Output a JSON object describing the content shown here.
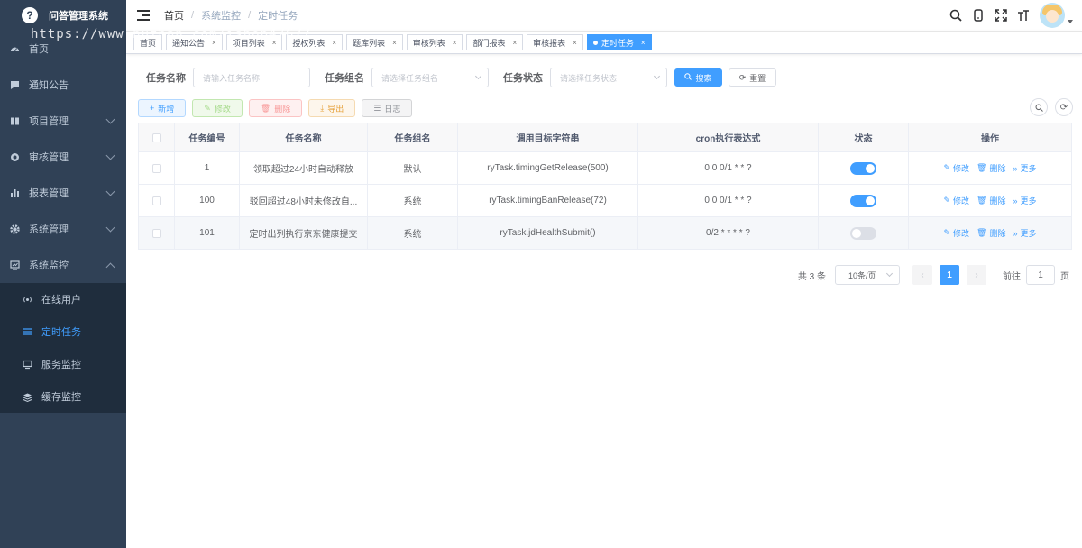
{
  "app": {
    "title": "问答管理系统",
    "logo_glyph": "?"
  },
  "watermark": "https://www.huzhan.com/ishop47677",
  "sidebar": {
    "items": [
      {
        "label": "首页",
        "icon": "dashboard-icon"
      },
      {
        "label": "通知公告",
        "icon": "message-icon"
      },
      {
        "label": "项目管理",
        "icon": "book-icon",
        "expandable": true
      },
      {
        "label": "审核管理",
        "icon": "audit-icon",
        "expandable": true
      },
      {
        "label": "报表管理",
        "icon": "chart-icon",
        "expandable": true
      },
      {
        "label": "系统管理",
        "icon": "gear-icon",
        "expandable": true
      },
      {
        "label": "系统监控",
        "icon": "monitor-icon",
        "expandable": true,
        "expanded": true
      }
    ],
    "submenu": [
      {
        "label": "在线用户",
        "icon": "online-icon"
      },
      {
        "label": "定时任务",
        "icon": "clock-icon",
        "active": true
      },
      {
        "label": "服务监控",
        "icon": "server-icon"
      },
      {
        "label": "缓存监控",
        "icon": "cache-icon"
      }
    ]
  },
  "header": {
    "breadcrumb": [
      "首页",
      "系统监控",
      "定时任务"
    ]
  },
  "tags": [
    {
      "label": "首页",
      "closable": false
    },
    {
      "label": "通知公告",
      "closable": true
    },
    {
      "label": "项目列表",
      "closable": true
    },
    {
      "label": "授权列表",
      "closable": true
    },
    {
      "label": "题库列表",
      "closable": true
    },
    {
      "label": "审核列表",
      "closable": true
    },
    {
      "label": "部门报表",
      "closable": true
    },
    {
      "label": "审核报表",
      "closable": true
    },
    {
      "label": "定时任务",
      "closable": true,
      "active": true
    }
  ],
  "search": {
    "name_label": "任务名称",
    "name_placeholder": "请输入任务名称",
    "group_label": "任务组名",
    "group_placeholder": "请选择任务组名",
    "status_label": "任务状态",
    "status_placeholder": "请选择任务状态",
    "search_btn": "搜索",
    "reset_btn": "重置"
  },
  "toolbar": {
    "add": "新增",
    "edit": "修改",
    "delete": "删除",
    "export": "导出",
    "log": "日志"
  },
  "table": {
    "columns": [
      "任务编号",
      "任务名称",
      "任务组名",
      "调用目标字符串",
      "cron执行表达式",
      "状态",
      "操作"
    ],
    "rows": [
      {
        "id": "1",
        "name": "领取超过24小时自动释放",
        "group": "默认",
        "target": "ryTask.timingGetRelease(500)",
        "cron": "0 0 0/1 * * ?",
        "enabled": true
      },
      {
        "id": "100",
        "name": "驳回超过48小时未修改自...",
        "group": "系统",
        "target": "ryTask.timingBanRelease(72)",
        "cron": "0 0 0/1 * * ?",
        "enabled": true
      },
      {
        "id": "101",
        "name": "定时出列执行京东健康提交",
        "group": "系统",
        "target": "ryTask.jdHealthSubmit()",
        "cron": "0/2 * * * * ?",
        "enabled": false
      }
    ],
    "ops": {
      "edit": "修改",
      "delete": "删除",
      "more": "更多"
    }
  },
  "pagination": {
    "total": "共 3 条",
    "page_size": "10条/页",
    "current": "1",
    "goto_label": "前往",
    "goto_value": "1",
    "page_suffix": "页"
  },
  "colors": {
    "sidebar_bg": "#304156",
    "primary": "#409eff"
  }
}
